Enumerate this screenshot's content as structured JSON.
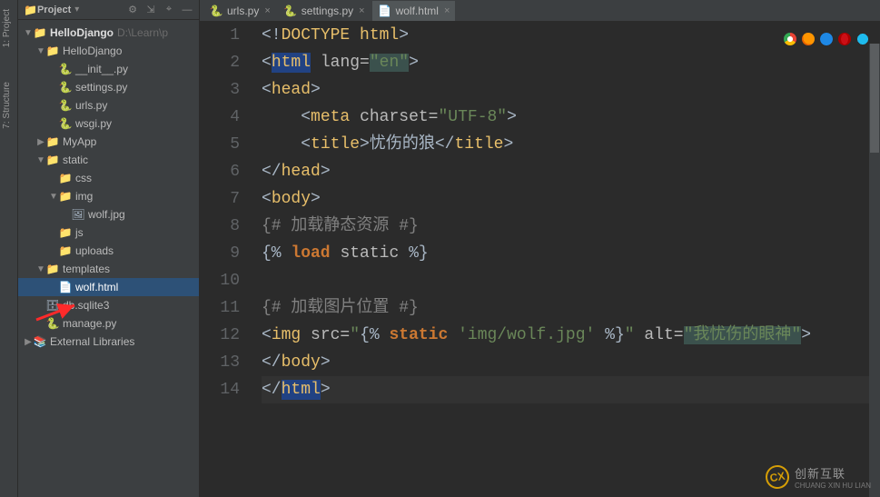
{
  "sidebar": {
    "title": "Project",
    "items": [
      {
        "indent": 0,
        "arrow": "▼",
        "icon": "📁",
        "label": "HelloDjango",
        "hint": "D:\\Learn\\p",
        "bold": true
      },
      {
        "indent": 1,
        "arrow": "▼",
        "icon": "📁",
        "label": "HelloDjango"
      },
      {
        "indent": 2,
        "arrow": "",
        "icon": "🐍",
        "label": "__init__.py"
      },
      {
        "indent": 2,
        "arrow": "",
        "icon": "🐍",
        "label": "settings.py"
      },
      {
        "indent": 2,
        "arrow": "",
        "icon": "🐍",
        "label": "urls.py"
      },
      {
        "indent": 2,
        "arrow": "",
        "icon": "🐍",
        "label": "wsgi.py"
      },
      {
        "indent": 1,
        "arrow": "▶",
        "icon": "📁",
        "label": "MyApp"
      },
      {
        "indent": 1,
        "arrow": "▼",
        "icon": "📁",
        "label": "static"
      },
      {
        "indent": 2,
        "arrow": "",
        "icon": "📁",
        "label": "css"
      },
      {
        "indent": 2,
        "arrow": "▼",
        "icon": "📁",
        "label": "img"
      },
      {
        "indent": 3,
        "arrow": "",
        "icon": "🖼",
        "label": "wolf.jpg"
      },
      {
        "indent": 2,
        "arrow": "",
        "icon": "📁",
        "label": "js"
      },
      {
        "indent": 2,
        "arrow": "",
        "icon": "📁",
        "label": "uploads"
      },
      {
        "indent": 1,
        "arrow": "▼",
        "icon": "📁",
        "label": "templates"
      },
      {
        "indent": 2,
        "arrow": "",
        "icon": "📄",
        "label": "wolf.html",
        "selected": true
      },
      {
        "indent": 1,
        "arrow": "",
        "icon": "🗄",
        "label": "db.sqlite3"
      },
      {
        "indent": 1,
        "arrow": "",
        "icon": "🐍",
        "label": "manage.py"
      },
      {
        "indent": 0,
        "arrow": "▶",
        "icon": "📚",
        "label": "External Libraries"
      }
    ]
  },
  "tabs": [
    {
      "icon": "🐍",
      "label": "urls.py",
      "active": false
    },
    {
      "icon": "🐍",
      "label": "settings.py",
      "active": false
    },
    {
      "icon": "📄",
      "label": "wolf.html",
      "active": true
    }
  ],
  "code": {
    "lines": [
      {
        "n": 1,
        "html": "<span class='c-punct'>&lt;!</span><span class='c-tag'>DOCTYPE html</span><span class='c-punct'>&gt;</span>"
      },
      {
        "n": 2,
        "html": "<span class='c-punct'>&lt;</span><span class='c-tag hl-bg'>html</span> <span class='c-attr'>lang=</span><span class='c-str hl-green'>\"en\"</span><span class='c-punct'>&gt;</span>"
      },
      {
        "n": 3,
        "html": "<span class='c-punct'>&lt;</span><span class='c-tag'>head</span><span class='c-punct'>&gt;</span>"
      },
      {
        "n": 4,
        "html": "    <span class='c-punct'>&lt;</span><span class='c-tag'>meta</span> <span class='c-attr'>charset=</span><span class='c-str'>\"UTF-8\"</span><span class='c-punct'>&gt;</span>"
      },
      {
        "n": 5,
        "html": "    <span class='c-punct'>&lt;</span><span class='c-tag'>title</span><span class='c-punct'>&gt;</span><span class='c-text'>忧伤的狼</span><span class='c-punct'>&lt;/</span><span class='c-tag'>title</span><span class='c-punct'>&gt;</span>"
      },
      {
        "n": 6,
        "html": "<span class='c-punct'>&lt;/</span><span class='c-tag'>head</span><span class='c-punct'>&gt;</span>"
      },
      {
        "n": 7,
        "html": "<span class='c-punct'>&lt;</span><span class='c-tag'>body</span><span class='c-punct'>&gt;</span>"
      },
      {
        "n": 8,
        "html": "<span class='c-cmt'>{# 加载静态资源 #}</span>"
      },
      {
        "n": 9,
        "html": "<span class='c-punct'>{% </span><span class='c-djtag'>load</span> <span class='c-attr'>static</span> <span class='c-punct'>%}</span>"
      },
      {
        "n": 10,
        "html": ""
      },
      {
        "n": 11,
        "html": "<span class='c-cmt'>{# 加载图片位置 #}</span>"
      },
      {
        "n": 12,
        "html": "<span class='c-punct'>&lt;</span><span class='c-tag'>img</span> <span class='c-attr'>src=</span><span class='c-str'>\"</span><span class='c-punct'>{% </span><span class='c-djtag'>static</span> <span class='c-str'>'img/wolf.jpg'</span> <span class='c-punct'>%}</span><span class='c-str'>\"</span> <span class='c-attr'>alt=</span><span class='c-str hl-green'>\"我忧伤的眼神\"</span><span class='c-punct'>&gt;</span>"
      },
      {
        "n": 13,
        "html": "<span class='c-punct'>&lt;/</span><span class='c-tag'>body</span><span class='c-punct'>&gt;</span>"
      },
      {
        "n": 14,
        "html": "<span class='c-punct'>&lt;/</span><span class='c-tag hl-bg'>html</span><span class='c-punct'>&gt;</span>",
        "current": true
      }
    ]
  },
  "toolstrip": {
    "tab1": "1: Project",
    "tab2": "7: Structure"
  },
  "watermark": {
    "cn": "创新互联",
    "en": "CHUANG XIN HU LIAN"
  }
}
